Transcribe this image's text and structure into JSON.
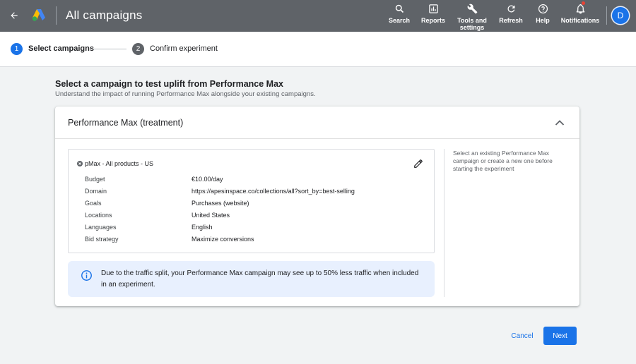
{
  "app": {
    "title": "All campaigns"
  },
  "toolbar": {
    "search": "Search",
    "reports": "Reports",
    "tools_line1": "Tools and",
    "tools_line2": "settings",
    "refresh": "Refresh",
    "help": "Help",
    "notifications": "Notifications",
    "avatar_initial": "D"
  },
  "stepper": {
    "steps": [
      {
        "number": "1",
        "label": "Select campaigns",
        "state": "active"
      },
      {
        "number": "2",
        "label": "Confirm experiment",
        "state": "inactive"
      }
    ]
  },
  "main": {
    "heading": "Select a campaign to test uplift from Performance Max",
    "subheading": "Understand the impact of running Performance Max alongside your existing campaigns."
  },
  "card": {
    "title": "Performance Max (treatment)",
    "campaign": {
      "name": "pMax - All products - US",
      "rows": [
        {
          "label": "Budget",
          "value": "€10.00/day"
        },
        {
          "label": "Domain",
          "value": "https://apesinspace.co/collections/all?sort_by=best-selling"
        },
        {
          "label": "Goals",
          "value": "Purchases (website)"
        },
        {
          "label": "Locations",
          "value": "United States"
        },
        {
          "label": "Languages",
          "value": "English"
        },
        {
          "label": "Bid strategy",
          "value": "Maximize conversions"
        }
      ]
    },
    "info_text": "Due to the traffic split, your Performance Max campaign may see up to 50% less traffic when included in an experiment.",
    "side_note": "Select an existing Performance Max campaign or create a new one before starting the experiment"
  },
  "footer": {
    "cancel": "Cancel",
    "next": "Next"
  },
  "colors": {
    "accent": "#1a73e8",
    "topbar": "#5f6368",
    "info_bg": "#e8f0fe"
  },
  "icons": [
    "arrow-back-icon",
    "google-ads-logo",
    "search-icon",
    "reports-icon",
    "wrench-icon",
    "refresh-icon",
    "help-icon",
    "bell-icon",
    "pencil-icon",
    "chevron-up-icon",
    "info-icon"
  ]
}
